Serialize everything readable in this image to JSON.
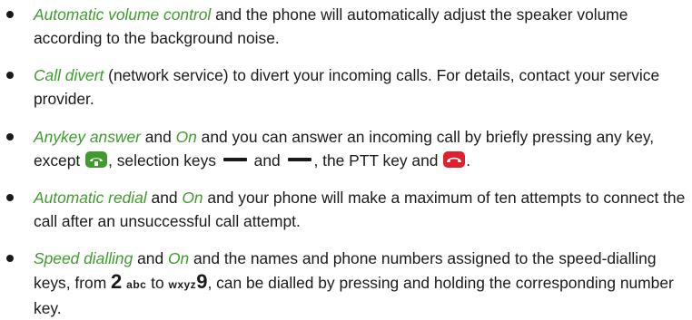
{
  "bullets": [
    {
      "option": "Automatic volume control",
      "text": " and the phone will automatically adjust the speaker volume according to the background noise."
    },
    {
      "option": "Call divert",
      "text": " (network service) to divert your incoming calls. For details, contact your service provider."
    },
    {
      "option": "Anykey answer",
      "and_text": " and ",
      "value": "On",
      "text_a": " and you can answer an incoming call by briefly pressing any key, except ",
      "text_b": ", selection keys ",
      "text_c": " and ",
      "text_d": ", the PTT key and ",
      "text_e": "."
    },
    {
      "option": "Automatic redial",
      "and_text": " and ",
      "value": "On",
      "text": " and your phone will make a maximum of ten attempts to connect the call after an unsuccessful call attempt."
    },
    {
      "option": "Speed dialling",
      "and_text": " and ",
      "value": "On",
      "text_a": " and the names and phone numbers assigned to the speed-dialling keys, from ",
      "key2_digit": "2",
      "key2_letters": "abc",
      "text_b": " to ",
      "key9_letters": "wxyz",
      "key9_digit": "9",
      "text_c": ", can be dialled by pressing and holding the corresponding number key."
    }
  ],
  "icons": [
    "call-key-icon",
    "selection-key-icon",
    "end-key-icon"
  ],
  "colors": {
    "option_green": "#3f9b2f",
    "text": "#1a1a1a"
  }
}
